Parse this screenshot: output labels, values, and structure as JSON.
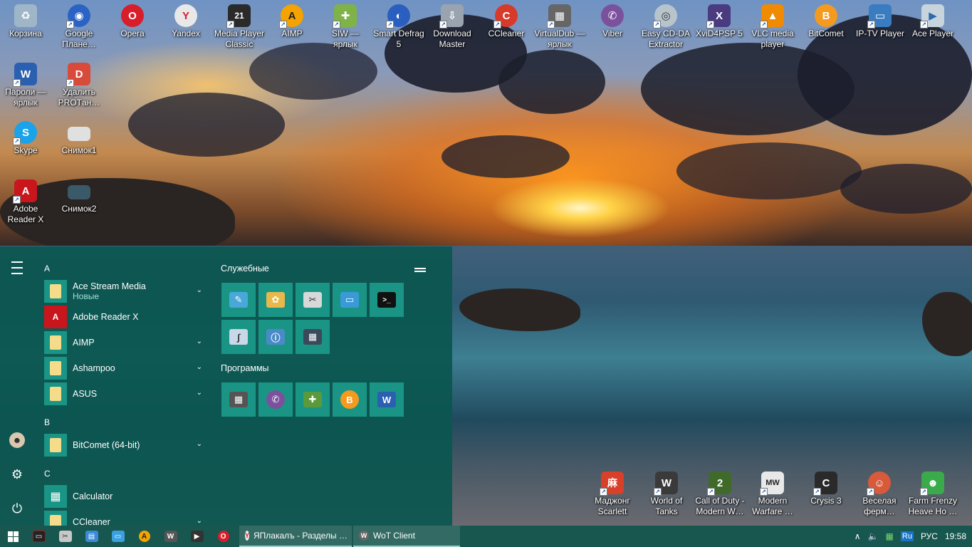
{
  "desktop": {
    "icons_top": [
      {
        "label": "Корзина",
        "icon": "recycle-bin-icon",
        "color": "#9fb6c8",
        "glyph": "♻"
      },
      {
        "label": "Google Плане…",
        "icon": "google-earth-icon",
        "color": "#2b63c5",
        "glyph": "◉"
      },
      {
        "label": "Opera",
        "icon": "opera-icon",
        "color": "#d81e2a",
        "glyph": "O"
      },
      {
        "label": "Yandex",
        "icon": "yandex-browser-icon",
        "color": "#e8e8e8",
        "glyph": "Y"
      },
      {
        "label": "Media Player Classic",
        "icon": "media-player-classic-icon",
        "color": "#2a2a2a",
        "glyph": "21"
      },
      {
        "label": "AIMP",
        "icon": "aimp-icon",
        "color": "#f4a300",
        "glyph": "A"
      },
      {
        "label": "SIW — ярлык",
        "icon": "siw-icon",
        "color": "#7fb347",
        "glyph": "✚"
      },
      {
        "label": "Smart Defrag 5",
        "icon": "smart-defrag-icon",
        "color": "#2a5fc0",
        "glyph": "◐"
      },
      {
        "label": "Download Master",
        "icon": "download-master-icon",
        "color": "#9aa4b0",
        "glyph": "⇩"
      },
      {
        "label": "CCleaner",
        "icon": "ccleaner-icon",
        "color": "#d83a2a",
        "glyph": "C"
      },
      {
        "label": "VirtualDub — ярлык",
        "icon": "virtualdub-icon",
        "color": "#666666",
        "glyph": "▦"
      },
      {
        "label": "Viber",
        "icon": "viber-icon",
        "color": "#7b519d",
        "glyph": "✆"
      },
      {
        "label": "Easy CD-DA Extractor",
        "icon": "cd-extractor-icon",
        "color": "#b8c4cc",
        "glyph": "◎"
      },
      {
        "label": "XviD4PSP 5",
        "icon": "xvid4psp-icon",
        "color": "#4a3a80",
        "glyph": "X"
      },
      {
        "label": "VLC media player",
        "icon": "vlc-icon",
        "color": "#f08a00",
        "glyph": "▲"
      },
      {
        "label": "BitComet",
        "icon": "bitcomet-icon",
        "color": "#f49a1e",
        "glyph": "B"
      },
      {
        "label": "IP-TV Player",
        "icon": "iptv-player-icon",
        "color": "#3a7cc0",
        "glyph": "▭"
      },
      {
        "label": "Ace Player",
        "icon": "ace-player-icon",
        "color": "#c8d4dc",
        "glyph": "▶"
      }
    ],
    "icons_left": [
      {
        "label": "Пароли — ярлык",
        "icon": "word-document-icon",
        "color": "#2b5fb0",
        "glyph": "W"
      },
      {
        "label": "Удалить PROTан…",
        "icon": "uninstall-icon",
        "color": "#d84a3a",
        "glyph": "D"
      },
      {
        "label": "Skype",
        "icon": "skype-icon",
        "color": "#1aa3e8",
        "glyph": "S"
      },
      {
        "label": "Снимок1",
        "icon": "image-file-icon",
        "color": "#e0e0e0",
        "glyph": "▭"
      },
      {
        "label": "Adobe Reader X",
        "icon": "adobe-reader-icon",
        "color": "#c9161d",
        "glyph": "A"
      },
      {
        "label": "Снимок2",
        "icon": "image-file-icon",
        "color": "#3a5a6a",
        "glyph": "▭"
      }
    ],
    "icons_bottom": [
      {
        "label": "Маджонг Scarlett",
        "icon": "mahjong-icon",
        "color": "#d8402a",
        "glyph": "麻"
      },
      {
        "label": "World of Tanks",
        "icon": "world-of-tanks-icon",
        "color": "#3a3a3a",
        "glyph": "W"
      },
      {
        "label": "Call of Duty - Modern W…",
        "icon": "call-of-duty-mw2-icon",
        "color": "#3f6a2a",
        "glyph": "2"
      },
      {
        "label": "Modern Warfare …",
        "icon": "call-of-duty-mw-icon",
        "color": "#e8e8e8",
        "glyph": "MW"
      },
      {
        "label": "Crysis 3",
        "icon": "crysis-icon",
        "color": "#2a2a2a",
        "glyph": "C"
      },
      {
        "label": "Веселая ферм…",
        "icon": "farm-game-icon",
        "color": "#d85a3a",
        "glyph": "☺"
      },
      {
        "label": "Farm Frenzy Heave Ho …",
        "icon": "farm-frenzy-icon",
        "color": "#3aaa4a",
        "glyph": "☻"
      }
    ]
  },
  "start_menu": {
    "rail": {
      "menu_icon": "hamburger-icon",
      "user_icon": "user-avatar-icon",
      "settings_icon": "gear-icon",
      "power_icon": "power-icon",
      "settings_glyph": "⚙",
      "power_glyph": "⏻"
    },
    "letters": {
      "a": "A",
      "b": "B",
      "c": "C"
    },
    "apps": {
      "ace_stream": {
        "name": "Ace Stream Media",
        "sub": "Новые"
      },
      "adobe_reader": {
        "name": "Adobe Reader X"
      },
      "aimp": {
        "name": "AIMP"
      },
      "ashampoo": {
        "name": "Ashampoo"
      },
      "asus": {
        "name": "ASUS"
      },
      "bitcomet": {
        "name": "BitComet (64-bit)"
      },
      "calculator": {
        "name": "Calculator"
      },
      "ccleaner": {
        "name": "CCleaner"
      }
    },
    "groups": {
      "utilities": {
        "title": "Служебные",
        "tiles": [
          {
            "icon": "notepad-icon",
            "color": "#4aa8d8",
            "glyph": "✎"
          },
          {
            "icon": "paint-icon",
            "color": "#e8b84a",
            "glyph": "🎨"
          },
          {
            "icon": "snipping-tool-icon",
            "color": "#d8d8d8",
            "glyph": "✂"
          },
          {
            "icon": "remote-desktop-icon",
            "color": "#3a9ad8",
            "glyph": "▭"
          },
          {
            "icon": "command-prompt-icon",
            "color": "#111111",
            "glyph": ">_"
          },
          {
            "icon": "math-input-icon",
            "color": "#c8d8e8",
            "glyph": "∫"
          },
          {
            "icon": "system-info-icon",
            "color": "#4a8ac8",
            "glyph": "ⓘ"
          },
          {
            "icon": "calculator-icon",
            "color": "#3a4a5a",
            "glyph": "▦"
          }
        ]
      },
      "programs": {
        "title": "Программы",
        "tiles": [
          {
            "icon": "virtualdub-icon",
            "color": "#555555",
            "glyph": "▦"
          },
          {
            "icon": "viber-icon",
            "color": "#7b519d",
            "glyph": "✆"
          },
          {
            "icon": "siw-icon",
            "color": "#5a9a3a",
            "glyph": "✚"
          },
          {
            "icon": "bitcomet-icon",
            "color": "#f49a1e",
            "glyph": "B"
          },
          {
            "icon": "word-icon",
            "color": "#2b5fb0",
            "glyph": "W"
          }
        ]
      }
    },
    "chevron": "⌄"
  },
  "taskbar": {
    "pinned": [
      {
        "icon": "show-desktop-icon",
        "color": "#222222",
        "glyph": "▭"
      },
      {
        "icon": "snipping-tool-icon",
        "color": "#c8c8c8",
        "glyph": "✂"
      },
      {
        "icon": "control-panel-icon",
        "color": "#3a8ad8",
        "glyph": "▤"
      },
      {
        "icon": "this-pc-icon",
        "color": "#3aa0e0",
        "glyph": "▭"
      },
      {
        "icon": "aimp-icon",
        "color": "#f4a300",
        "glyph": "A"
      },
      {
        "icon": "world-of-tanks-icon",
        "color": "#555555",
        "glyph": "W"
      },
      {
        "icon": "media-player-classic-icon",
        "color": "#333333",
        "glyph": "▶"
      },
      {
        "icon": "opera-icon",
        "color": "#d81e2a",
        "glyph": "O"
      }
    ],
    "tasks": [
      {
        "label": "ЯПлакалъ - Разделы …",
        "icon": "yandex-browser-icon",
        "color": "#e8e8e8",
        "glyph": "Y"
      },
      {
        "label": "WoT Client",
        "icon": "world-of-tanks-icon",
        "color": "#666666",
        "glyph": "W"
      }
    ],
    "tray": {
      "chevron": "∧",
      "volume": "🔈",
      "network": "▦",
      "keyboard_badge": "Ru",
      "language": "РУС",
      "time": "19:58"
    }
  }
}
